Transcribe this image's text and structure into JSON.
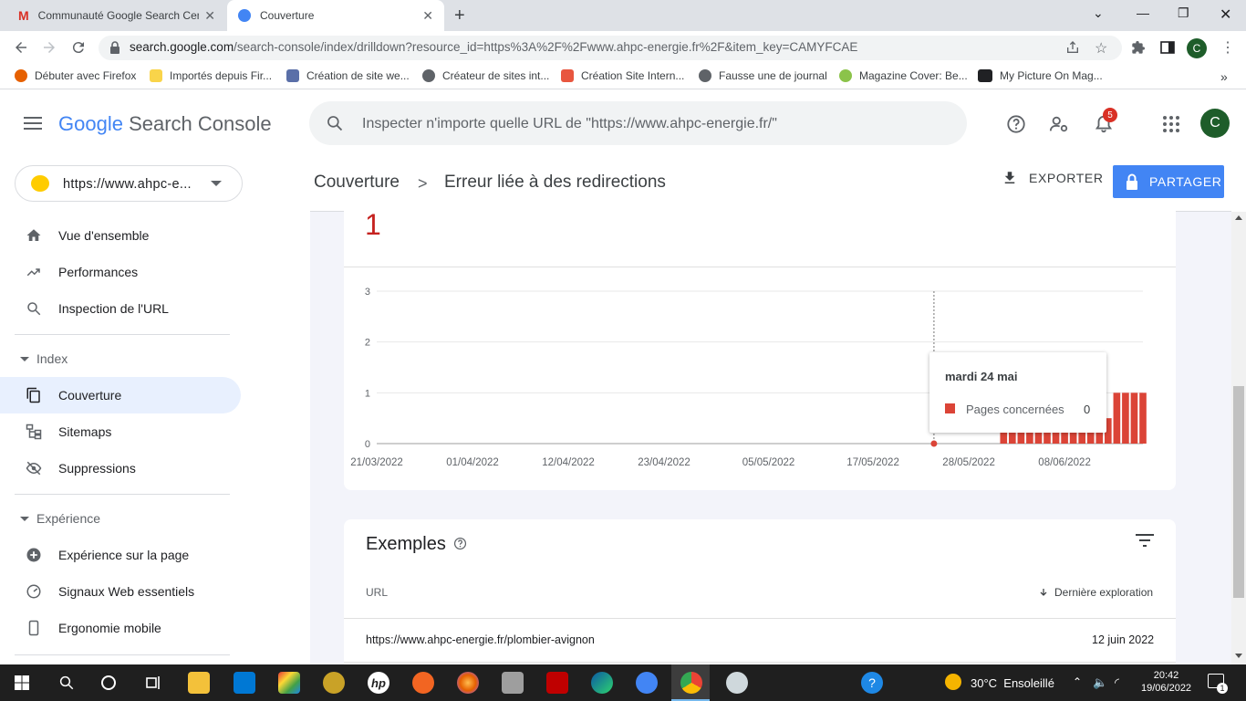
{
  "browser": {
    "tabs": [
      {
        "title": "Communauté Google Search Cen"
      },
      {
        "title": "Couverture"
      }
    ],
    "url_host": "search.google.com",
    "url_path": "/search-console/index/drilldown?resource_id=https%3A%2F%2Fwww.ahpc-energie.fr%2F&item_key=CAMYFCAE",
    "profile_letter": "C",
    "bookmarks": [
      "Débuter avec Firefox",
      "Importés depuis Fir...",
      "Création de site we...",
      "Créateur de sites int...",
      "Création Site Intern...",
      "Fausse une de journal",
      "Magazine Cover: Be...",
      "My Picture On Mag..."
    ],
    "bookmarks_more": "»"
  },
  "app": {
    "logo_google": "Google",
    "logo_product": "Search Console",
    "search_placeholder": "Inspecter n'importe quelle URL de \"https://www.ahpc-energie.fr/\"",
    "notif_count": "5",
    "avatar_letter": "C"
  },
  "sidebar": {
    "property": "https://www.ahpc-e...",
    "top_items": [
      {
        "label": "Vue d'ensemble",
        "icon": "home-icon"
      },
      {
        "label": "Performances",
        "icon": "trending-icon"
      },
      {
        "label": "Inspection de l'URL",
        "icon": "search-icon"
      }
    ],
    "index_section": "Index",
    "index_items": [
      {
        "label": "Couverture",
        "icon": "copy-icon",
        "active": true
      },
      {
        "label": "Sitemaps",
        "icon": "sitemap-icon"
      },
      {
        "label": "Suppressions",
        "icon": "eye-off-icon"
      }
    ],
    "experience_section": "Expérience",
    "experience_items": [
      {
        "label": "Expérience sur la page",
        "icon": "plus-circle-icon"
      },
      {
        "label": "Signaux Web essentiels",
        "icon": "gauge-icon"
      },
      {
        "label": "Ergonomie mobile",
        "icon": "phone-icon"
      }
    ]
  },
  "main": {
    "breadcrumb_parent": "Couverture",
    "breadcrumb_sep": ">",
    "breadcrumb_current": "Erreur liée à des redirections",
    "export_label": "EXPORTER",
    "share_label": "PARTAGER",
    "big_number": "1",
    "tooltip": {
      "date": "mardi 24 mai",
      "series": "Pages concernées",
      "value": "0"
    },
    "examples": {
      "title": "Exemples",
      "col_url": "URL",
      "col_last": "Dernière exploration",
      "rows": [
        {
          "url": "https://www.ahpc-energie.fr/plombier-avignon",
          "date": "12 juin 2022"
        }
      ]
    }
  },
  "chart_data": {
    "type": "bar",
    "x_tick_labels": [
      "21/03/2022",
      "01/04/2022",
      "12/04/2022",
      "23/04/2022",
      "05/05/2022",
      "17/05/2022",
      "28/05/2022",
      "08/06/2022"
    ],
    "y_ticks": [
      0,
      1,
      2,
      3
    ],
    "ylim": [
      0,
      3
    ],
    "series": [
      {
        "name": "Pages concernées",
        "color": "#db4437"
      }
    ],
    "x_start": "2022-03-21",
    "x_end": "2022-06-17",
    "bars": [
      {
        "date": "2022-06-01",
        "value": 0.5
      },
      {
        "date": "2022-06-02",
        "value": 0.5
      },
      {
        "date": "2022-06-03",
        "value": 0.5
      },
      {
        "date": "2022-06-04",
        "value": 0.5
      },
      {
        "date": "2022-06-05",
        "value": 0.5
      },
      {
        "date": "2022-06-06",
        "value": 0.5
      },
      {
        "date": "2022-06-07",
        "value": 0.5
      },
      {
        "date": "2022-06-08",
        "value": 0.5
      },
      {
        "date": "2022-06-09",
        "value": 0.5
      },
      {
        "date": "2022-06-10",
        "value": 0.5
      },
      {
        "date": "2022-06-11",
        "value": 0.5
      },
      {
        "date": "2022-06-12",
        "value": 0.5
      },
      {
        "date": "2022-06-13",
        "value": 0.5
      },
      {
        "date": "2022-06-14",
        "value": 1
      },
      {
        "date": "2022-06-15",
        "value": 1
      },
      {
        "date": "2022-06-16",
        "value": 1
      },
      {
        "date": "2022-06-17",
        "value": 1
      }
    ],
    "hover": {
      "date": "2022-05-24",
      "value": 0
    }
  },
  "taskbar": {
    "temperature": "30°C",
    "weather": "Ensoleillé",
    "time": "20:42",
    "date": "19/06/2022",
    "notifications": "1"
  }
}
